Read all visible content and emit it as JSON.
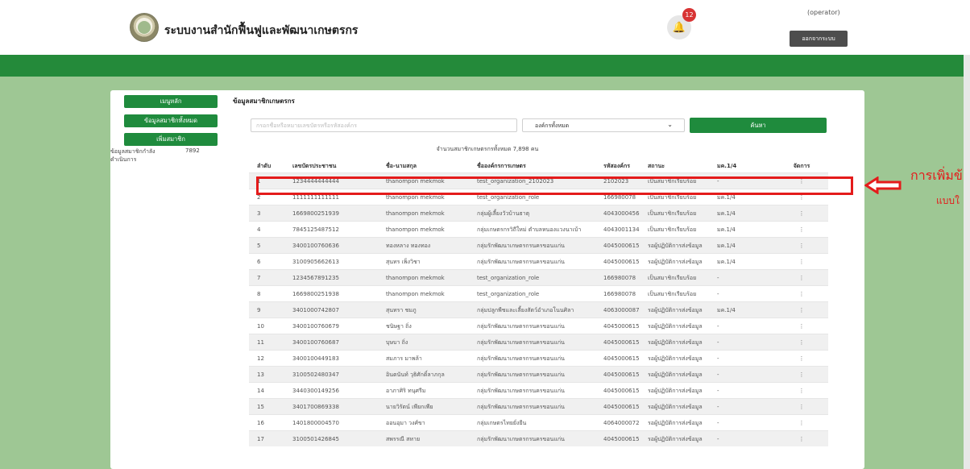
{
  "header": {
    "app_title": "ระบบงานสำนักฟื้นฟูและพัฒนาเกษตรกร",
    "notification_count": "12",
    "user_role": "(operator)",
    "logout_label": "ออกจากระบบ",
    "bell_icon": "bell-icon",
    "logo_icon": "agency-seal-logo"
  },
  "sidebar": {
    "items": [
      {
        "label": "เมนูหลัก"
      },
      {
        "label": "ข้อมูลสมาชิกทั้งหมด"
      },
      {
        "label": "เพิ่มสมาชิก"
      }
    ],
    "member_count_label": "ข้อมูลสมาชิกกำลังดำเนินการ",
    "member_count_value": "7892"
  },
  "main": {
    "section_title": "ข้อมูลสมาชิกเกษตรกร",
    "search_placeholder": "กรอกชื่อหรือหมายเลขบัตรหรือรหัสองค์กร",
    "org_select_value": "องค์กรทั้งหมด",
    "search_button": "ค้นหา",
    "total_text": "จำนวนสมาชิกเกษตรกรทั้งหมด 7,898 คน",
    "table": {
      "headers": [
        "ลำดับ",
        "เลขบัตรประชาชน",
        "ชื่อ-นามสกุล",
        "ชื่อองค์กรการเกษตร",
        "รหัสองค์กร",
        "สถานะ",
        "มค.1/4",
        "จัดการ"
      ],
      "rows": [
        [
          "1",
          "1234444444444",
          "thanompon mekmok",
          "test_organization_2102023",
          "2102023",
          "เป็นสมาชิกเรียบร้อย",
          "-",
          "⋮"
        ],
        [
          "2",
          "1111111111111",
          "thanompon mekmok",
          "test_organization_role",
          "166980078",
          "เป็นสมาชิกเรียบร้อย",
          "มค.1/4",
          "⋮"
        ],
        [
          "3",
          "1669800251939",
          "thanompon mekmok",
          "กลุ่มผู้เลี้ยงวัวบ้านธาตุ",
          "4043000456",
          "เป็นสมาชิกเรียบร้อย",
          "มค.1/4",
          "⋮"
        ],
        [
          "4",
          "7845125487512",
          "thanompon mekmok",
          "กลุ่มเกษตรกรวิถีใหม่ ตำบลหนองแวงนาเบ้า",
          "4043001134",
          "เป็นสมาชิกเรียบร้อย",
          "มค.1/4",
          "⋮"
        ],
        [
          "5",
          "3400100760636",
          "ทองหลาง ทองทอง",
          "กลุ่มรักพัฒนาเกษตรกรนครขอนแก่น",
          "4045000615",
          "รอผู้ปฏิบัติการส่งข้อมูล",
          "มค.1/4",
          "⋮"
        ],
        [
          "6",
          "3100905662613",
          "สุนทร เพ็งวิชา",
          "กลุ่มรักพัฒนาเกษตรกรนครขอนแก่น",
          "4045000615",
          "รอผู้ปฏิบัติการส่งข้อมูล",
          "มค.1/4",
          "⋮"
        ],
        [
          "7",
          "1234567891235",
          "thanompon mekmok",
          "test_organization_role",
          "166980078",
          "เป็นสมาชิกเรียบร้อย",
          "-",
          "⋮"
        ],
        [
          "8",
          "1669800251938",
          "thanompon mekmok",
          "test_organization_role",
          "166980078",
          "เป็นสมาชิกเรียบร้อย",
          "-",
          "⋮"
        ],
        [
          "9",
          "3401000742807",
          "สุนทรา ชมภู",
          "กลุ่มปลูกพืชและเลี้ยงสัตว์อำเภอโนนศิลา",
          "4063000087",
          "รอผู้ปฏิบัติการส่งข้อมูล",
          "มค.1/4",
          "⋮"
        ],
        [
          "10",
          "3400100760679",
          "ชนิษฐา ถิ่ง",
          "กลุ่มรักพัฒนาเกษตรกรนครขอนแก่น",
          "4045000615",
          "รอผู้ปฏิบัติการส่งข้อมูล",
          "-",
          "⋮"
        ],
        [
          "11",
          "3400100760687",
          "บุษบา ถิ่ง",
          "กลุ่มรักพัฒนาเกษตรกรนครขอนแก่น",
          "4045000615",
          "รอผู้ปฏิบัติการส่งข้อมูล",
          "-",
          "⋮"
        ],
        [
          "12",
          "3400100449183",
          "สมภาร มาพล้า",
          "กลุ่มรักพัฒนาเกษตรกรนครขอนแก่น",
          "4045000615",
          "รอผู้ปฏิบัติการส่งข้อมูล",
          "-",
          "⋮"
        ],
        [
          "13",
          "3100502480347",
          "อินตนันท์ วุธิศักดิ์ลาภกุล",
          "กลุ่มรักพัฒนาเกษตรกรนครขอนแก่น",
          "4045000615",
          "รอผู้ปฏิบัติการส่งข้อมูล",
          "-",
          "⋮"
        ],
        [
          "14",
          "3440300149256",
          "อาภาศิริ ทนุศรีม",
          "กลุ่มรักพัฒนาเกษตรกรนครขอนแก่น",
          "4045000615",
          "รอผู้ปฏิบัติการส่งข้อมูล",
          "-",
          "⋮"
        ],
        [
          "15",
          "3401700869338",
          "นายวิรัตน์ เพียกเพีย",
          "กลุ่มรักพัฒนาเกษตรกรนครขอนแก่น",
          "4045000615",
          "รอผู้ปฏิบัติการส่งข้อมูล",
          "-",
          "⋮"
        ],
        [
          "16",
          "1401800004570",
          "ออนอุมา วงศ์ขา",
          "กลุ่มเกษตรไทยยั่งยืน",
          "4064000072",
          "รอผู้ปฏิบัติการส่งข้อมูล",
          "-",
          "⋮"
        ],
        [
          "17",
          "3100501426845",
          "สพรรณี สหาย",
          "กลุ่มรักพัฒนาเกษตรกรนครขอนแก่น",
          "4045000615",
          "รอผู้ปฏิบัติการส่งข้อมูล",
          "-",
          "⋮"
        ]
      ]
    }
  },
  "annotation": {
    "line1": "การเพิ่มข้",
    "line2": "แบบใ",
    "arrow_icon": "left-arrow-icon",
    "color": "#e41b1b"
  },
  "colors": {
    "brand_green": "#1f8b3d",
    "band_green": "#248a3a",
    "page_background": "#9ec794",
    "badge_red": "#d83434"
  }
}
